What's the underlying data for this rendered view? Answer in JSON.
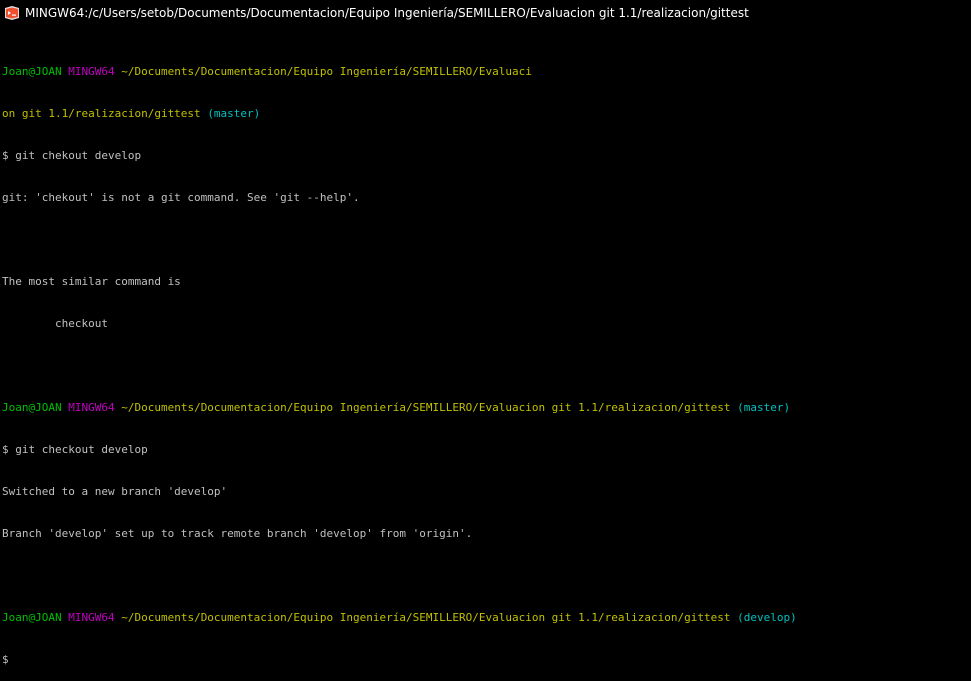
{
  "window": {
    "title": "MINGW64:/c/Users/setob/Documents/Documentacion/Equipo Ingeniería/SEMILLERO/Evaluacion git 1.1/realizacion/gittest",
    "icon": "git-bash-icon"
  },
  "colors": {
    "background": "#000000",
    "text": "#c0c0c0",
    "user": "#00c000",
    "host": "#c000c0",
    "path": "#c0c000",
    "branch": "#00c0c0"
  },
  "terminal": {
    "block1": {
      "user": "Joan@JOAN",
      "host": "MINGW64",
      "path_line1": "~/Documents/Documentacion/Equipo Ingeniería/SEMILLERO/Evaluaci",
      "path_line2": "on git 1.1/realizacion/gittest",
      "branch": "(master)",
      "command": "$ git chekout develop",
      "output": [
        "git: 'chekout' is not a git command. See 'git --help'.",
        "",
        "The most similar command is",
        "        checkout"
      ]
    },
    "block2": {
      "user": "Joan@JOAN",
      "host": "MINGW64",
      "path": "~/Documents/Documentacion/Equipo Ingeniería/SEMILLERO/Evaluacion git 1.1/realizacion/gittest",
      "branch": "(master)",
      "command": "$ git checkout develop",
      "output": [
        "Switched to a new branch 'develop'",
        "Branch 'develop' set up to track remote branch 'develop' from 'origin'."
      ]
    },
    "block3": {
      "user": "Joan@JOAN",
      "host": "MINGW64",
      "path": "~/Documents/Documentacion/Equipo Ingeniería/SEMILLERO/Evaluacion git 1.1/realizacion/gittest",
      "branch": "(develop)",
      "prompt": "$"
    }
  }
}
